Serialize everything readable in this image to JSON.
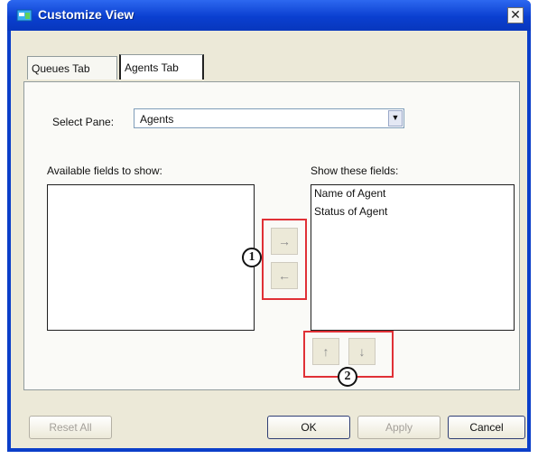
{
  "window": {
    "title": "Customize View",
    "close_symbol": "✕"
  },
  "tabs": [
    {
      "label": "Queues Tab",
      "selected": false
    },
    {
      "label": "Agents Tab",
      "selected": true
    }
  ],
  "select_pane": {
    "label": "Select Pane:",
    "value": "Agents"
  },
  "available_fields": {
    "label": "Available fields to show:",
    "items": []
  },
  "show_fields": {
    "label": "Show these fields:",
    "items": [
      "Name of Agent",
      "Status of Agent"
    ]
  },
  "move_buttons": {
    "add_symbol": "→",
    "remove_symbol": "←"
  },
  "order_buttons": {
    "up_symbol": "↑",
    "down_symbol": "↓"
  },
  "callouts": [
    "1",
    "2"
  ],
  "footer_buttons": {
    "reset_all": {
      "label": "Reset All",
      "enabled": false
    },
    "ok": {
      "label": "OK",
      "enabled": true
    },
    "apply": {
      "label": "Apply",
      "enabled": false
    },
    "cancel": {
      "label": "Cancel",
      "enabled": true
    }
  },
  "colors": {
    "titlebar": "#0a3fd0",
    "dialog_bg": "#ece9d8",
    "highlight_box": "#e03036"
  }
}
